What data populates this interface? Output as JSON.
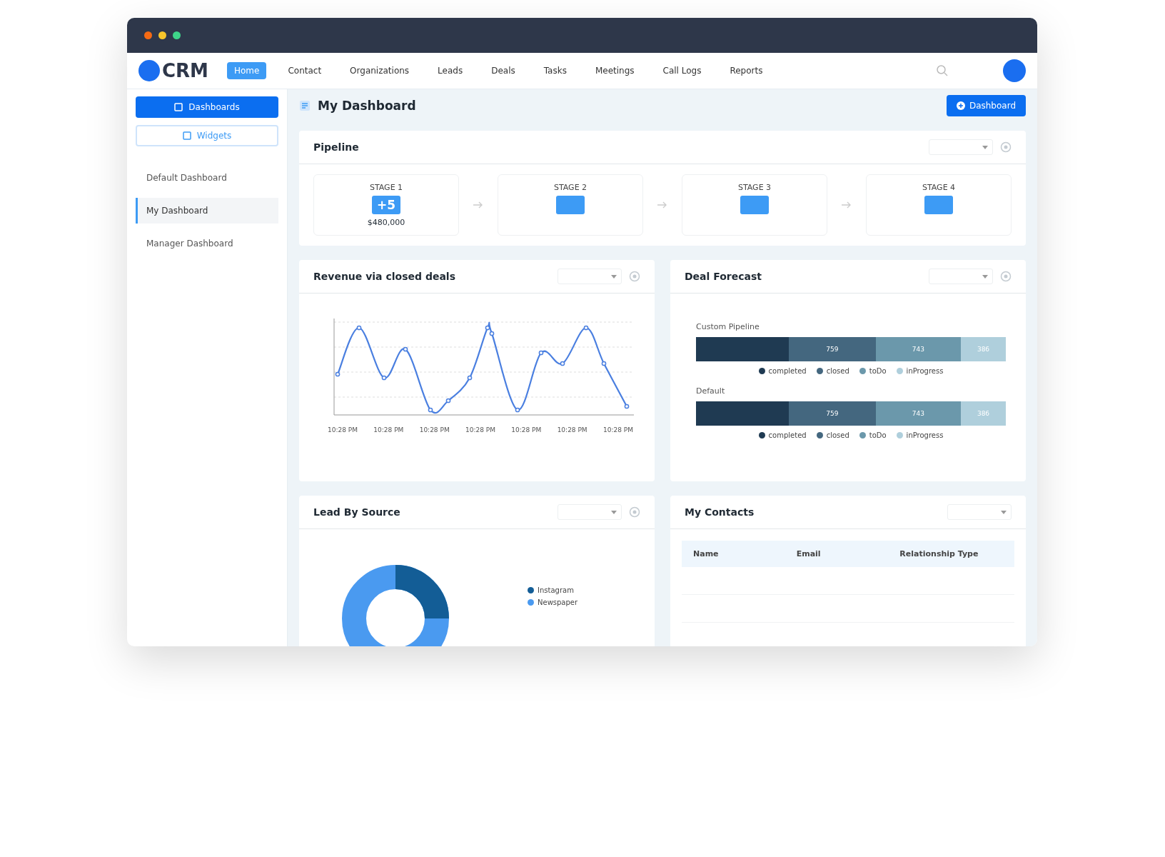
{
  "app": {
    "logo": "CRM"
  },
  "nav": [
    {
      "label": "Home",
      "selected": true
    },
    {
      "label": "Contact",
      "selected": false
    },
    {
      "label": "Organizations",
      "selected": false
    },
    {
      "label": "Leads",
      "selected": false
    },
    {
      "label": "Deals",
      "selected": false
    },
    {
      "label": "Tasks",
      "selected": false
    },
    {
      "label": "Meetings",
      "selected": false
    },
    {
      "label": "Call Logs",
      "selected": false
    },
    {
      "label": "Reports",
      "selected": false
    }
  ],
  "sidebar": {
    "buttons": [
      {
        "label": "Dashboards",
        "kind": "primary"
      },
      {
        "label": "Widgets",
        "kind": "outline"
      }
    ],
    "items": [
      {
        "label": "Default Dashboard",
        "selected": false
      },
      {
        "label": "My Dashboard",
        "selected": true
      },
      {
        "label": "Manager Dashboard",
        "selected": false
      }
    ]
  },
  "page": {
    "title": "My Dashboard",
    "button": "Dashboard"
  },
  "pipeline": {
    "title": "Pipeline",
    "stages": [
      {
        "name": "STAGE 1",
        "count": "+5",
        "amount": "$480,000"
      },
      {
        "name": "STAGE 2"
      },
      {
        "name": "STAGE 3"
      },
      {
        "name": "STAGE 4"
      }
    ]
  },
  "revenue": {
    "title": "Revenue via closed deals",
    "x_labels": [
      "10:28 PM",
      "10:28 PM",
      "10:28 PM",
      "10:28 PM",
      "10:28 PM",
      "10:28 PM",
      "10:28 PM"
    ]
  },
  "forecast": {
    "title": "Deal Forecast",
    "groups": [
      {
        "title": "Custom Pipeline",
        "segments": [
          {
            "color": "#1f3a52"
          },
          {
            "label": "759",
            "color": "#44677f"
          },
          {
            "label": "743",
            "color": "#6b98ab"
          },
          {
            "label": "386",
            "color": "#afcfdc"
          }
        ],
        "legend": [
          {
            "label": "completed",
            "color": "#1f3a52"
          },
          {
            "label": "closed",
            "color": "#44677f"
          },
          {
            "label": "toDo",
            "color": "#6b98ab"
          },
          {
            "label": "inProgress",
            "color": "#afcfdc"
          }
        ]
      },
      {
        "title": "Default",
        "segments": [
          {
            "color": "#1f3a52"
          },
          {
            "label": "759",
            "color": "#44677f"
          },
          {
            "label": "743",
            "color": "#6b98ab"
          },
          {
            "label": "386",
            "color": "#afcfdc"
          }
        ],
        "legend": [
          {
            "label": "completed",
            "color": "#1f3a52"
          },
          {
            "label": "closed",
            "color": "#44677f"
          },
          {
            "label": "toDo",
            "color": "#6b98ab"
          },
          {
            "label": "inProgress",
            "color": "#afcfdc"
          }
        ]
      }
    ]
  },
  "lead_source": {
    "title": "Lead By Source",
    "legend": [
      {
        "label": "Instagram",
        "color": "#135d96"
      },
      {
        "label": "Newspaper",
        "color": "#4a9af0"
      }
    ]
  },
  "contacts": {
    "title": "My Contacts",
    "columns": [
      "Name",
      "Email",
      "Relationship Type"
    ]
  }
}
